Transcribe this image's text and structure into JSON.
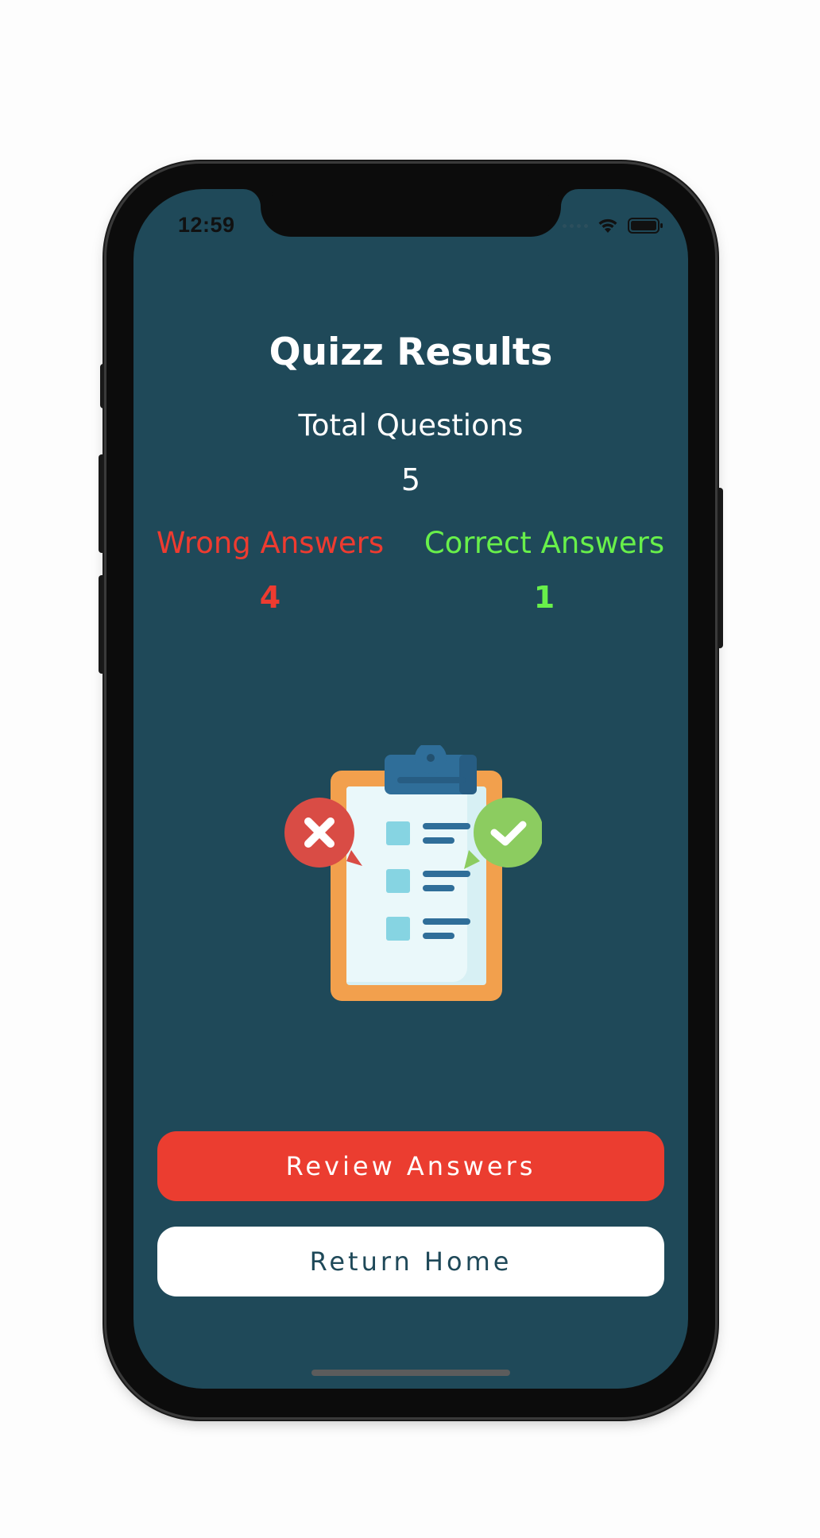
{
  "status_bar": {
    "time": "12:59"
  },
  "quiz_results": {
    "title": "Quizz Results",
    "total_label": "Total Questions",
    "total_value": "5",
    "wrong_label": "Wrong Answers",
    "wrong_value": "4",
    "correct_label": "Correct Answers",
    "correct_value": "1"
  },
  "actions": {
    "review_label": "Review Answers",
    "home_label": "Return Home"
  },
  "colors": {
    "background": "#1f4959",
    "wrong": "#ee3b30",
    "correct": "#68f04a",
    "review_button": "#eb3d30",
    "home_button": "#ffffff"
  },
  "icons": {
    "illustration": "clipboard-checklist-icon",
    "wrong_badge": "x-bubble-icon",
    "correct_badge": "check-bubble-icon",
    "wifi": "wifi-icon",
    "battery": "battery-icon",
    "signal": "signal-icon"
  }
}
